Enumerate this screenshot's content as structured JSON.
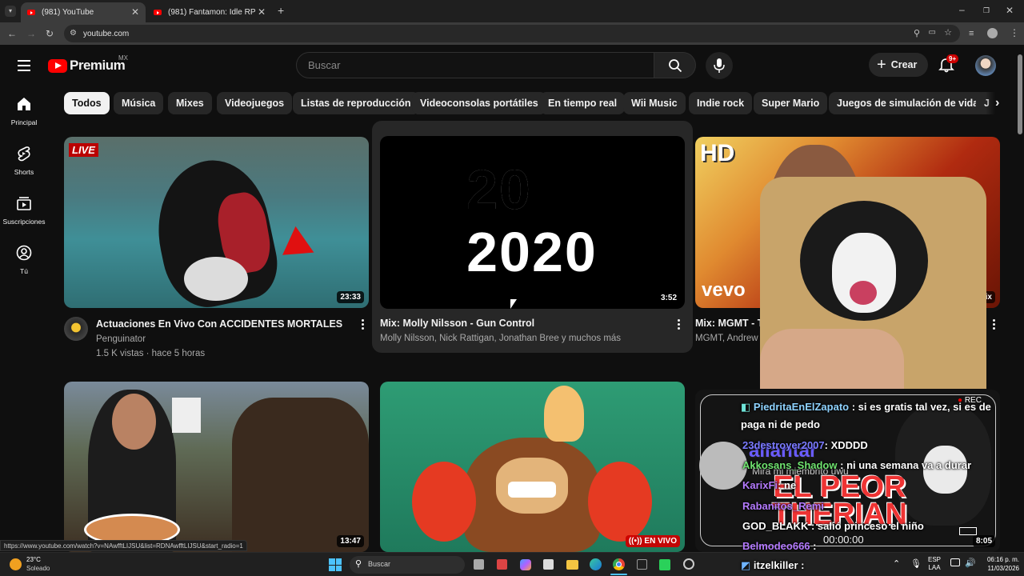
{
  "browser": {
    "tabs": [
      {
        "title": "(981) YouTube",
        "active": true
      },
      {
        "title": "(981) Fantamon: Idle RPG Game",
        "active": false
      }
    ],
    "url": "youtube.com",
    "status_url": "https://www.youtube.com/watch?v=NAwfftLIJSU&list=RDNAwfftLIJSU&start_radio=1"
  },
  "header": {
    "logo_text": "Premium",
    "region": "MX",
    "search_placeholder": "Buscar",
    "create_label": "Crear",
    "notifications_badge": "9+"
  },
  "sidebar": {
    "items": [
      {
        "label": "Principal",
        "icon": "home-icon"
      },
      {
        "label": "Shorts",
        "icon": "shorts-icon"
      },
      {
        "label": "Suscripciones",
        "icon": "subscriptions-icon"
      },
      {
        "label": "Tú",
        "icon": "you-icon"
      }
    ]
  },
  "chips": [
    "Todos",
    "Música",
    "Mixes",
    "Videojuegos",
    "Listas de reproducción",
    "Videoconsolas portátiles",
    "En tiempo real",
    "Wii Music",
    "Indie rock",
    "Super Mario",
    "Juegos de simulación de vida",
    "J"
  ],
  "videos": [
    {
      "title": "Actuaciones En Vivo Con ACCIDENTES MORTALES",
      "channel": "Penguinator",
      "stats": "1.5 K vistas · hace 5 horas",
      "duration": "23:33",
      "badge": "LIVE"
    },
    {
      "title": "Mix: Molly Nilsson - Gun Control",
      "channel": "Molly Nilsson, Nick Rattigan, Jonathan Bree y muchos más",
      "duration": "3:52",
      "thumb_text": [
        "2020",
        "2020"
      ]
    },
    {
      "title": "Mix: MGMT - Tim",
      "channel": "MGMT, Andrew V",
      "badge": "HD",
      "brand": "vevo",
      "mix_label": "Mix"
    },
    {
      "duration": "13:47"
    },
    {
      "live_label": "EN VIVO"
    },
    {
      "duration": "8:05"
    }
  ],
  "overlay": {
    "chat": [
      {
        "user": "PiedritaEnElZapato",
        "msg": ": si es gratis tal vez, si es de",
        "color": "#8fd3ff"
      },
      {
        "user": "",
        "msg": "paga ni de pedo",
        "color": "#ffffff"
      },
      {
        "user": "23destroyer2007",
        "msg": ": XDDDD",
        "color": "#7b7bff"
      },
      {
        "user": "Akkosans_Shadow",
        "msg": ": ni una semana va a durar",
        "color": "#6fe36f"
      },
      {
        "user": "KarixFi",
        "msg": ": ne",
        "color": "#b57bff"
      },
      {
        "user": "Rabanitos_Remi",
        "msg": "",
        "color": "#b57bff"
      },
      {
        "user": "GOD_BLAKK",
        "msg": ": salió princeso el niño",
        "color": "#ffffff"
      },
      {
        "user": "Belmodeo666",
        "msg": ":",
        "color": "#b57bff"
      },
      {
        "user": "itzelkiller",
        "msg": ":",
        "color": "#ffffff"
      }
    ],
    "stream_name": "allantar",
    "sub_text": "Mira mi miembrito uwu",
    "big_text": [
      "EL PEOR",
      "THERIAN"
    ],
    "rec": "REC",
    "timer": "00:00:00"
  },
  "taskbar": {
    "weather_temp": "23°C",
    "weather_desc": "Soleado",
    "search_label": "Buscar",
    "lang": "ESP",
    "lang2": "LAA",
    "time": "06:16 p. m.",
    "date": "11/03/2026"
  },
  "colors": {
    "accent_red": "#ff0000",
    "bg": "#0f0f0f",
    "chip": "#272727"
  }
}
